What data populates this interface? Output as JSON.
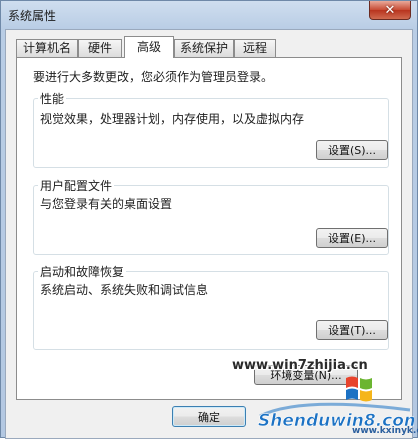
{
  "window": {
    "title": "系统属性",
    "close_glyph": "✕"
  },
  "tabs": [
    {
      "label": "计算机名",
      "active": false
    },
    {
      "label": "硬件",
      "active": false
    },
    {
      "label": "高级",
      "active": true
    },
    {
      "label": "系统保护",
      "active": false
    },
    {
      "label": "远程",
      "active": false
    }
  ],
  "advanced": {
    "notice": "要进行大多数更改，您必须作为管理员登录。",
    "performance": {
      "title": "性能",
      "description": "视觉效果，处理器计划，内存使用，以及虚拟内存",
      "button": "设置(S)..."
    },
    "user_profiles": {
      "title": "用户配置文件",
      "description": "与您登录有关的桌面设置",
      "button": "设置(E)..."
    },
    "startup_recovery": {
      "title": "启动和故障恢复",
      "description": "系统启动、系统失败和调试信息",
      "button": "设置(T)..."
    },
    "env_button": "环境变量(N)..."
  },
  "footer": {
    "ok_button": "确定"
  },
  "watermark": {
    "url": "www.win7zhijia.cn",
    "logo_text": "Shenduwin8.com",
    "site": "www.kxinyk.com"
  },
  "colors": {
    "title_gradient_top": "#cfdeef",
    "close_red": "#c74a33",
    "focus_blue": "#3c7fb1",
    "watermark_blue": "#1c72c4"
  }
}
